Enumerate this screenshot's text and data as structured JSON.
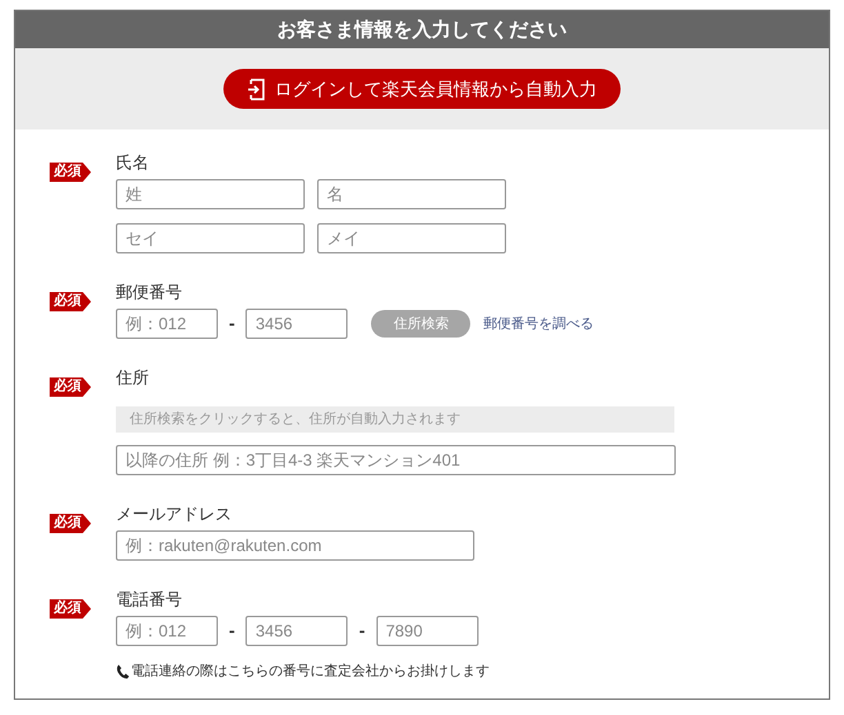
{
  "header": {
    "title": "お客さま情報を入力してください"
  },
  "login_button": {
    "label": "ログインして楽天会員情報から自動入力"
  },
  "sections": [
    {
      "kind": "name",
      "badge": "必須",
      "label": "氏名",
      "rows": [
        [
          {
            "kind": "field",
            "placeholder": "姓"
          },
          {
            "kind": "field",
            "placeholder": "名"
          }
        ],
        [
          {
            "kind": "field",
            "placeholder": "セイ"
          },
          {
            "kind": "field",
            "placeholder": "メイ"
          }
        ]
      ]
    },
    {
      "kind": "postal",
      "badge": "必須",
      "label": "郵便番号",
      "rows": [
        [
          {
            "kind": "field",
            "placeholder": "例：012"
          },
          {
            "kind": "separator",
            "text": "-"
          },
          {
            "kind": "field",
            "placeholder": "3456"
          },
          {
            "kind": "button",
            "text": "住所検索",
            "disabled": true
          },
          {
            "kind": "link",
            "text": "郵便番号を調べる"
          }
        ]
      ]
    },
    {
      "kind": "address",
      "badge": "必須",
      "label": "住所",
      "rows": [
        [
          {
            "kind": "readonly",
            "text": "住所検索をクリックすると、住所が自動入力されます"
          }
        ],
        [
          {
            "kind": "field",
            "placeholder": "以降の住所 例：3丁目4-3 楽天マンション401"
          }
        ]
      ]
    },
    {
      "kind": "email",
      "badge": "必須",
      "label": "メールアドレス",
      "rows": [
        [
          {
            "kind": "field",
            "placeholder": "例：rakuten@rakuten.com"
          }
        ]
      ]
    },
    {
      "kind": "phone",
      "badge": "必須",
      "label": "電話番号",
      "rows": [
        [
          {
            "kind": "field",
            "placeholder": "例：012"
          },
          {
            "kind": "separator",
            "text": "-"
          },
          {
            "kind": "field",
            "placeholder": "3456"
          },
          {
            "kind": "separator",
            "text": "-"
          },
          {
            "kind": "field",
            "placeholder": "7890"
          }
        ],
        [
          {
            "kind": "note",
            "text": "電話連絡の際はこちらの番号に査定会社からお掛けします"
          }
        ]
      ]
    }
  ]
}
